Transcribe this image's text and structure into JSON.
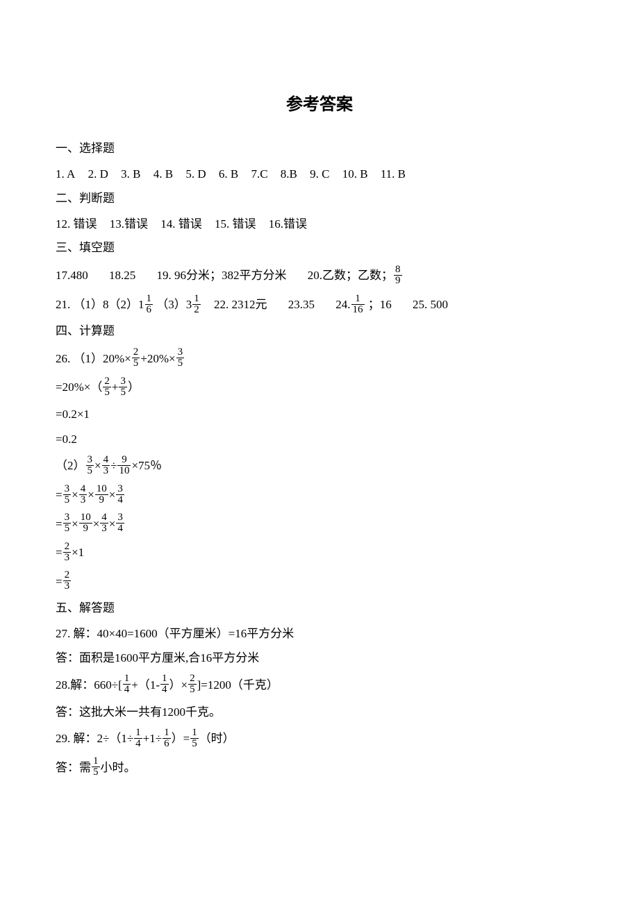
{
  "title": "参考答案",
  "sections": {
    "s1": "一、选择题",
    "s2": "二、判断题",
    "s3": "三、填空题",
    "s4": "四、计算题",
    "s5": "五、解答题"
  },
  "choice": {
    "a1": "1. A",
    "a2": "2. D",
    "a3": "3. B",
    "a4": "4. B",
    "a5": "5. D",
    "a6": "6. B",
    "a7": "7.C",
    "a8": "8.B",
    "a9": "9. C",
    "a10": "10. B",
    "a11": "11. B"
  },
  "judge": {
    "a12": "12. 错误",
    "a13": "13.错误",
    "a14": "14. 错误",
    "a15": "15. 错误",
    "a16": "16.错误"
  },
  "fill": {
    "a17": "17.480",
    "a18": "18.25",
    "a19": "19. 96分米；382平方分米",
    "a20a": "20.乙数；乙数；",
    "a20f_n": "8",
    "a20f_d": "9",
    "a21a": "21. （1）8（2）1",
    "a21f1_n": "1",
    "a21f1_d": "6",
    "a21b": "（3）3",
    "a21f2_n": "1",
    "a21f2_d": "2",
    "a22": "22. 2312元",
    "a23": "23.35",
    "a24a": "24.",
    "a24f_n": "1",
    "a24f_d": "16",
    "a24b": "；16",
    "a25": "25. 500"
  },
  "calc": {
    "p1a": "26. （1）20%×",
    "p1f1_n": "2",
    "p1f1_d": "5",
    "p1b": "+20%×",
    "p1f2_n": "3",
    "p1f2_d": "5",
    "p2a": "=20%×（",
    "p2f1_n": "2",
    "p2f1_d": "5",
    "p2b": "+",
    "p2f2_n": "3",
    "p2f2_d": "5",
    "p2c": "）",
    "p3": "=0.2×1",
    "p4": "=0.2",
    "q1a": "（2）",
    "q1f1_n": "3",
    "q1f1_d": "5",
    "q1f2_n": "4",
    "q1f2_d": "3",
    "q1f3_n": "9",
    "q1f3_d": "10",
    "q1b": "×75％",
    "q2a": "=",
    "q2f1_n": "3",
    "q2f1_d": "5",
    "q2f2_n": "4",
    "q2f2_d": "3",
    "q2f3_n": "10",
    "q2f3_d": "9",
    "q2f4_n": "3",
    "q2f4_d": "4",
    "q3a": "=",
    "q3f1_n": "3",
    "q3f1_d": "5",
    "q3f2_n": "10",
    "q3f2_d": "9",
    "q3f3_n": "4",
    "q3f3_d": "3",
    "q3f4_n": "3",
    "q3f4_d": "4",
    "q4a": "=",
    "q4f_n": "2",
    "q4f_d": "3",
    "q4b": "×1",
    "q5a": "=",
    "q5f_n": "2",
    "q5f_d": "3",
    "times": "×",
    "div": "÷"
  },
  "solve": {
    "p27a": "27. 解：40×40=1600（平方厘米）=16平方分米",
    "p27b": "答：面积是1600平方厘米,合16平方分米",
    "p28a1": "28.解：660÷[",
    "p28f1_n": "1",
    "p28f1_d": "4",
    "p28a2": "+（1-",
    "p28f2_n": "1",
    "p28f2_d": "4",
    "p28a3": "）×",
    "p28f3_n": "2",
    "p28f3_d": "5",
    "p28a4": "]=1200（千克）",
    "p28b": "答：这批大米一共有1200千克。",
    "p29a1": "29. 解：2÷（1÷",
    "p29f1_n": "1",
    "p29f1_d": "4",
    "p29a2": "+1÷",
    "p29f2_n": "1",
    "p29f2_d": "6",
    "p29a3": "）=",
    "p29f3_n": "1",
    "p29f3_d": "5",
    "p29a4": "（时）",
    "p29b1": "答：需",
    "p29bf_n": "1",
    "p29bf_d": "5",
    "p29b2": "小时。"
  }
}
